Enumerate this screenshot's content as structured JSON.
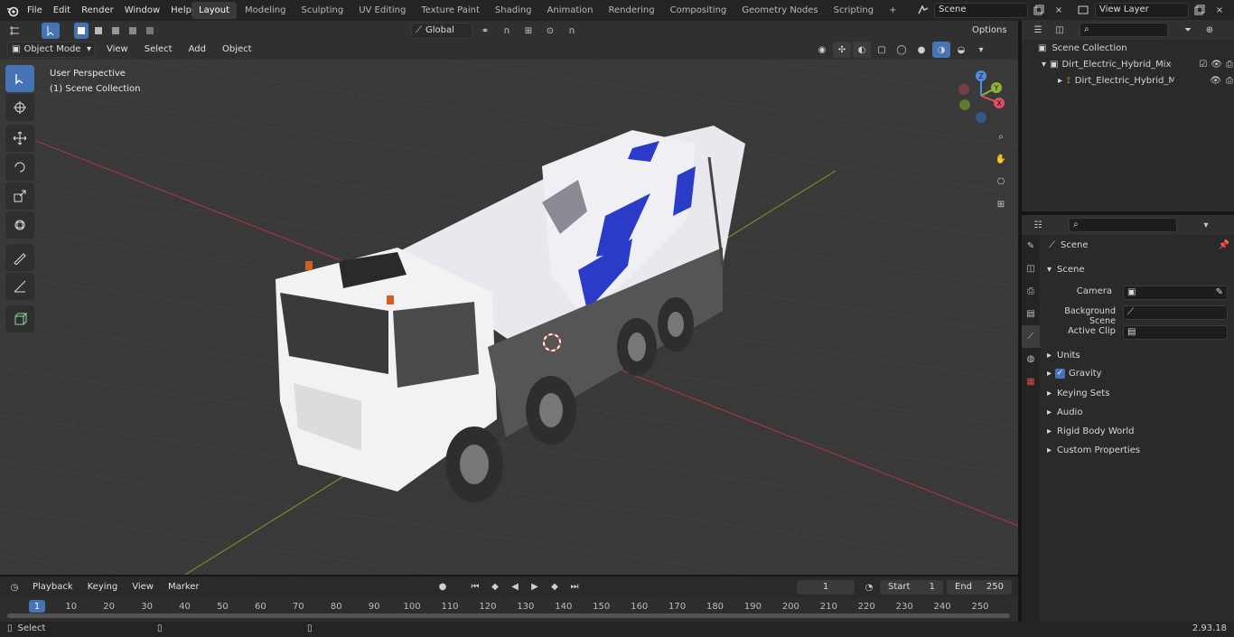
{
  "topbar": {
    "menus": [
      "File",
      "Edit",
      "Render",
      "Window",
      "Help"
    ],
    "workspaces": [
      "Layout",
      "Modeling",
      "Sculpting",
      "UV Editing",
      "Texture Paint",
      "Shading",
      "Animation",
      "Rendering",
      "Compositing",
      "Geometry Nodes",
      "Scripting"
    ],
    "active_workspace": "Layout",
    "add_tab": "+",
    "scene": "Scene",
    "view_layer": "View Layer"
  },
  "viewport_header": {
    "mode": "Object Mode",
    "menus": [
      "View",
      "Select",
      "Add",
      "Object"
    ],
    "transform_orientation": "Global",
    "options": "Options"
  },
  "viewport": {
    "perspective": "User Perspective",
    "collection": "(1) Scene Collection",
    "gizmo": {
      "x": "X",
      "y": "Y",
      "z": "Z"
    }
  },
  "outliner": {
    "root": "Scene Collection",
    "items": [
      {
        "label": "Dirt_Electric_Hybrid_Mixer_Sir"
      },
      {
        "label": "Dirt_Electric_Hybrid_Mixe"
      }
    ]
  },
  "properties": {
    "context": "Scene",
    "panel": "Scene",
    "fields": [
      {
        "label": "Camera"
      },
      {
        "label": "Background Scene"
      },
      {
        "label": "Active Clip"
      }
    ],
    "subpanels": [
      "Units",
      "Gravity",
      "Keying Sets",
      "Audio",
      "Rigid Body World",
      "Custom Properties"
    ]
  },
  "timeline": {
    "menus": [
      "Playback",
      "Keying",
      "View",
      "Marker"
    ],
    "current_frame": "1",
    "start_label": "Start",
    "start": "1",
    "end_label": "End",
    "end": "250",
    "ticks": [
      "1",
      "10",
      "20",
      "30",
      "40",
      "50",
      "60",
      "70",
      "80",
      "90",
      "100",
      "110",
      "120",
      "130",
      "140",
      "150",
      "160",
      "170",
      "180",
      "190",
      "200",
      "210",
      "220",
      "230",
      "240",
      "250"
    ]
  },
  "statusbar": {
    "action": "Select",
    "version": "2.93.18"
  }
}
